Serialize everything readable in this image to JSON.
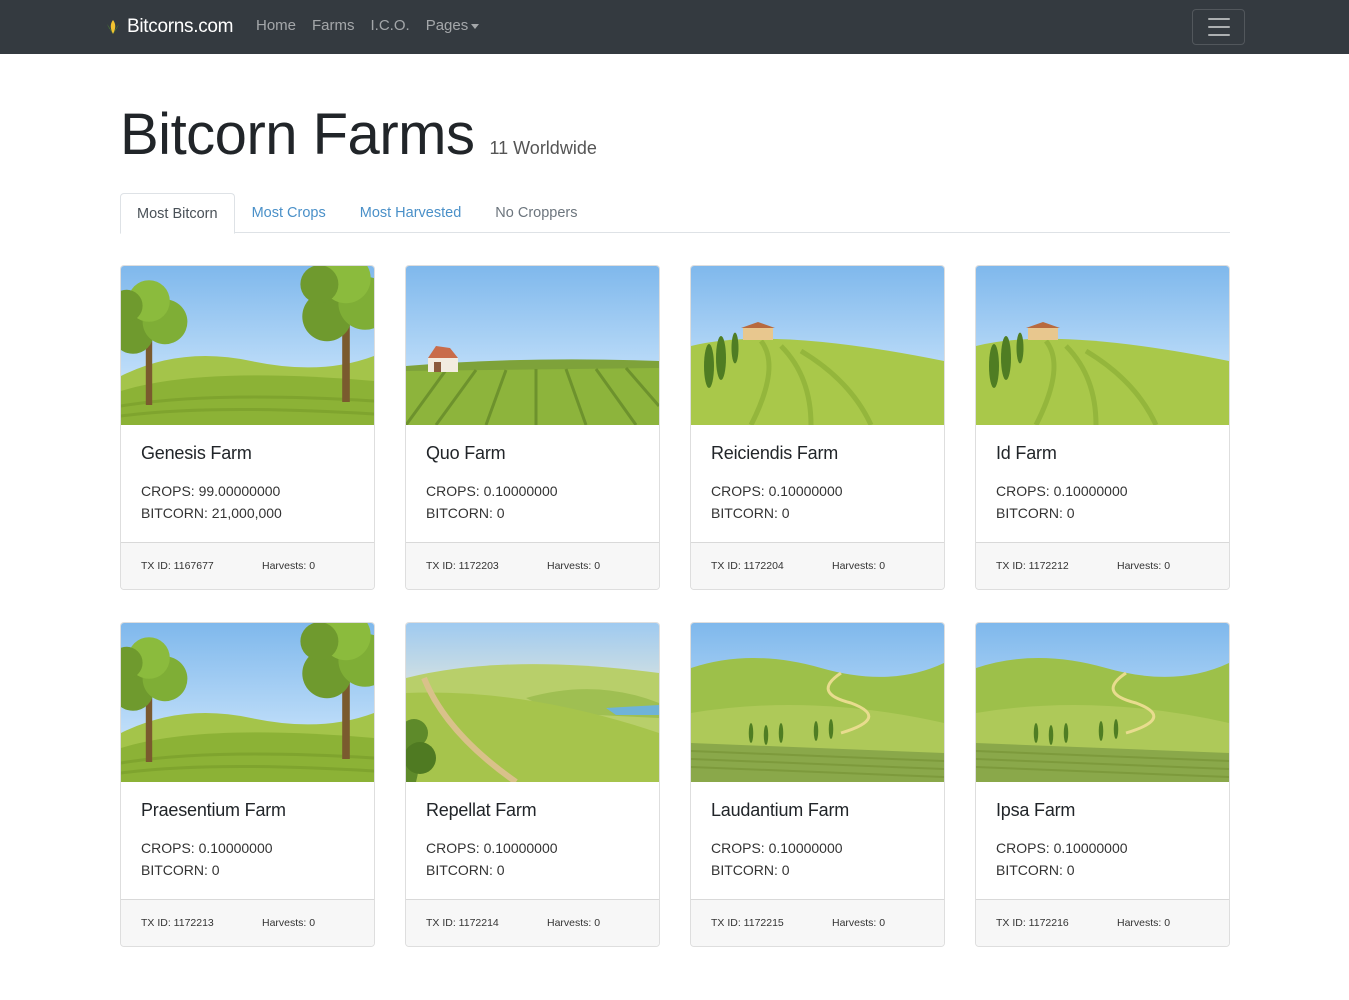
{
  "navbar": {
    "brand": "Bitcorns.com",
    "links": [
      "Home",
      "Farms",
      "I.C.O.",
      "Pages"
    ]
  },
  "header": {
    "title": "Bitcorn Farms",
    "subtitle": "11 Worldwide"
  },
  "tabs": [
    "Most Bitcorn",
    "Most Crops",
    "Most Harvested",
    "No Croppers"
  ],
  "colors": {
    "navbar_bg": "#343a40",
    "link": "#4a90c8",
    "footer_bg": "#f7f7f7"
  },
  "farms": [
    {
      "name": "Genesis Farm",
      "crops": "CROPS: 99.00000000",
      "bitcorn": "BITCORN: 21,000,000",
      "tx": "TX ID: 1167677",
      "harvests": "Harvests: 0"
    },
    {
      "name": "Quo Farm",
      "crops": "CROPS: 0.10000000",
      "bitcorn": "BITCORN: 0",
      "tx": "TX ID: 1172203",
      "harvests": "Harvests: 0"
    },
    {
      "name": "Reiciendis Farm",
      "crops": "CROPS: 0.10000000",
      "bitcorn": "BITCORN: 0",
      "tx": "TX ID: 1172204",
      "harvests": "Harvests: 0"
    },
    {
      "name": "Id Farm",
      "crops": "CROPS: 0.10000000",
      "bitcorn": "BITCORN: 0",
      "tx": "TX ID: 1172212",
      "harvests": "Harvests: 0"
    },
    {
      "name": "Praesentium Farm",
      "crops": "CROPS: 0.10000000",
      "bitcorn": "BITCORN: 0",
      "tx": "TX ID: 1172213",
      "harvests": "Harvests: 0"
    },
    {
      "name": "Repellat Farm",
      "crops": "CROPS: 0.10000000",
      "bitcorn": "BITCORN: 0",
      "tx": "TX ID: 1172214",
      "harvests": "Harvests: 0"
    },
    {
      "name": "Laudantium Farm",
      "crops": "CROPS: 0.10000000",
      "bitcorn": "BITCORN: 0",
      "tx": "TX ID: 1172215",
      "harvests": "Harvests: 0"
    },
    {
      "name": "Ipsa Farm",
      "crops": "CROPS: 0.10000000",
      "bitcorn": "BITCORN: 0",
      "tx": "TX ID: 1172216",
      "harvests": "Harvests: 0"
    }
  ]
}
